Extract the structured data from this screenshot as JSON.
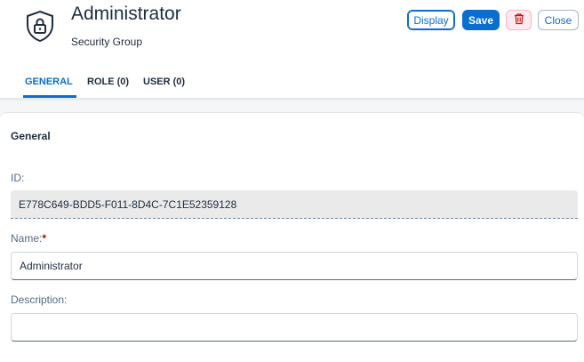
{
  "header": {
    "title": "Administrator",
    "subtitle": "Security Group",
    "icon": "shield-lock-icon"
  },
  "actions": {
    "display": "Display",
    "save": "Save",
    "delete_icon": "trash-icon",
    "close": "Close"
  },
  "tabs": [
    {
      "label": "GENERAL",
      "selected": true
    },
    {
      "label": "ROLE (0)",
      "selected": false
    },
    {
      "label": "USER (0)",
      "selected": false
    }
  ],
  "section": {
    "title": "General"
  },
  "form": {
    "id_label": "ID:",
    "id_value": "E778C649-BDD5-F011-8D4C-7C1E52359128",
    "name_label": "Name:",
    "name_required": "*",
    "name_value": "Administrator",
    "description_label": "Description:",
    "description_value": ""
  },
  "colors": {
    "accent": "#0a6ed1",
    "required": "#aa0808",
    "delete_bg": "#ffeaf0"
  }
}
